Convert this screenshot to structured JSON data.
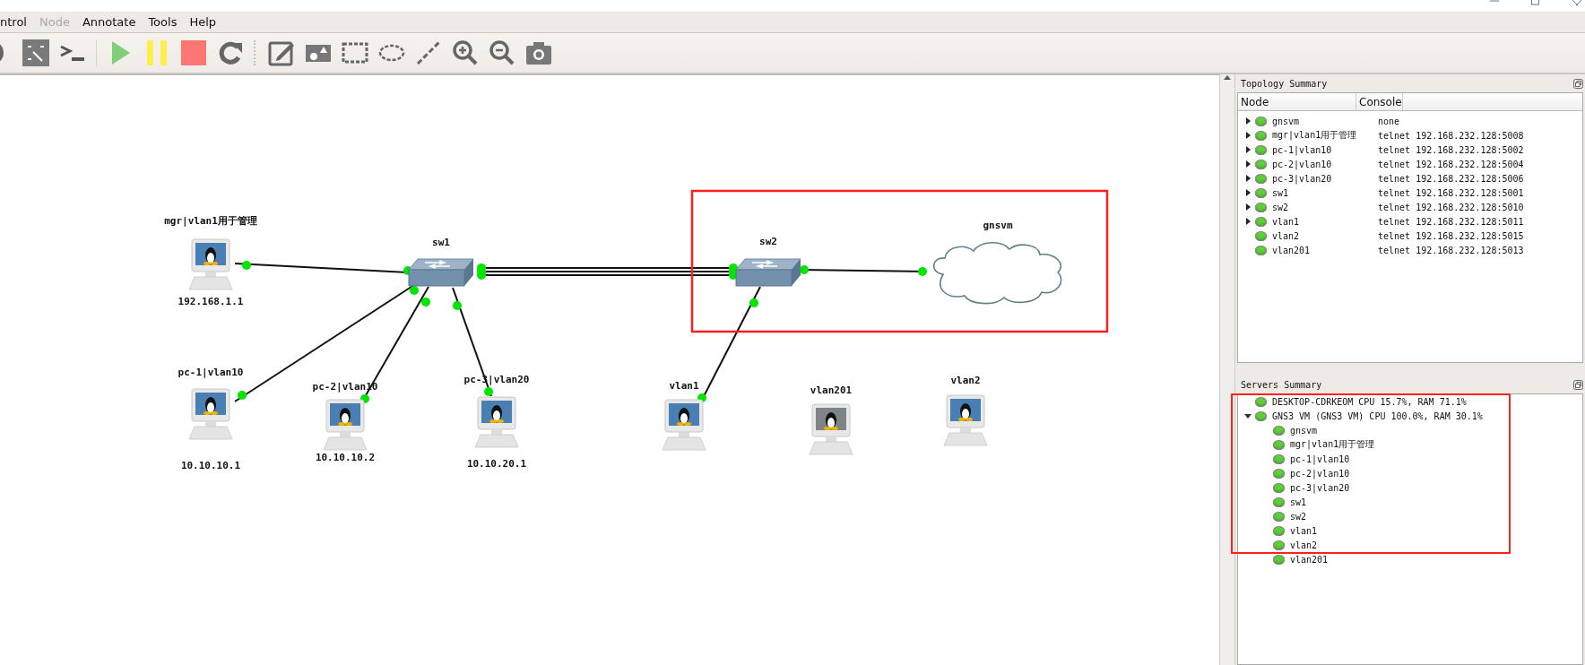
{
  "menu": [
    {
      "label": "ntrol",
      "disabled": false
    },
    {
      "label": "Node",
      "disabled": true
    },
    {
      "label": "Annotate",
      "disabled": false
    },
    {
      "label": "Tools",
      "disabled": false
    },
    {
      "label": "Help",
      "disabled": false
    }
  ],
  "canvas": {
    "nodes": [
      {
        "label": "mgr|vlan1用于管理",
        "kind": "computer",
        "address": "192.168.1.1",
        "dimmed": false
      },
      {
        "label": "sw1",
        "kind": "switch"
      },
      {
        "label": "sw2",
        "kind": "switch"
      },
      {
        "label": "gnsvm",
        "kind": "cloud"
      },
      {
        "label": "pc-1|vlan10",
        "kind": "computer",
        "address": "10.10.10.1",
        "dimmed": false
      },
      {
        "label": "pc-2|vlan10",
        "kind": "computer",
        "address": "10.10.10.2",
        "dimmed": false
      },
      {
        "label": "pc-3|vlan20",
        "kind": "computer",
        "address": "10.10.20.1",
        "dimmed": false
      },
      {
        "label": "vlan1",
        "kind": "computer",
        "dimmed": false
      },
      {
        "label": "vlan201",
        "kind": "computer",
        "dimmed": true
      },
      {
        "label": "vlan2",
        "kind": "computer",
        "dimmed": false
      }
    ]
  },
  "topology_summary": {
    "title": "Topology Summary",
    "columns": [
      "Node",
      "Console"
    ],
    "rows": [
      {
        "node": "gnsvm",
        "console": "none",
        "expanded": false,
        "running": true
      },
      {
        "node": "mgr|vlan1用于管理",
        "console": "telnet 192.168.232.128:5008",
        "expanded": false,
        "running": true
      },
      {
        "node": "pc-1|vlan10",
        "console": "telnet 192.168.232.128:5002",
        "expanded": false,
        "running": true
      },
      {
        "node": "pc-2|vlan10",
        "console": "telnet 192.168.232.128:5004",
        "expanded": false,
        "running": true
      },
      {
        "node": "pc-3|vlan20",
        "console": "telnet 192.168.232.128:5006",
        "expanded": false,
        "running": true
      },
      {
        "node": "sw1",
        "console": "telnet 192.168.232.128:5001",
        "expanded": false,
        "running": true
      },
      {
        "node": "sw2",
        "console": "telnet 192.168.232.128:5010",
        "expanded": false,
        "running": true
      },
      {
        "node": "vlan1",
        "console": "telnet 192.168.232.128:5011",
        "expanded": false,
        "running": true
      },
      {
        "node": "vlan2",
        "console": "telnet 192.168.232.128:5015",
        "running": true
      },
      {
        "node": "vlan201",
        "console": "telnet 192.168.232.128:5013",
        "running": true
      }
    ]
  },
  "servers_summary": {
    "title": "Servers Summary",
    "servers": [
      {
        "label": "DESKTOP-CDRKEOM CPU 15.7%, RAM 71.1%",
        "running": true
      },
      {
        "label": "GNS3 VM (GNS3 VM) CPU 100.0%, RAM 30.1%",
        "running": true,
        "expanded": true,
        "children": [
          {
            "label": "gnsvm",
            "running": true
          },
          {
            "label": "mgr|vlan1用于管理",
            "running": true
          },
          {
            "label": "pc-1|vlan10",
            "running": true
          },
          {
            "label": "pc-2|vlan10",
            "running": true
          },
          {
            "label": "pc-3|vlan20",
            "running": true
          },
          {
            "label": "sw1",
            "running": true
          },
          {
            "label": "sw2",
            "running": true
          },
          {
            "label": "vlan1",
            "running": true
          },
          {
            "label": "vlan2",
            "running": true
          },
          {
            "label": "vlan201",
            "running": true
          }
        ]
      }
    ]
  }
}
